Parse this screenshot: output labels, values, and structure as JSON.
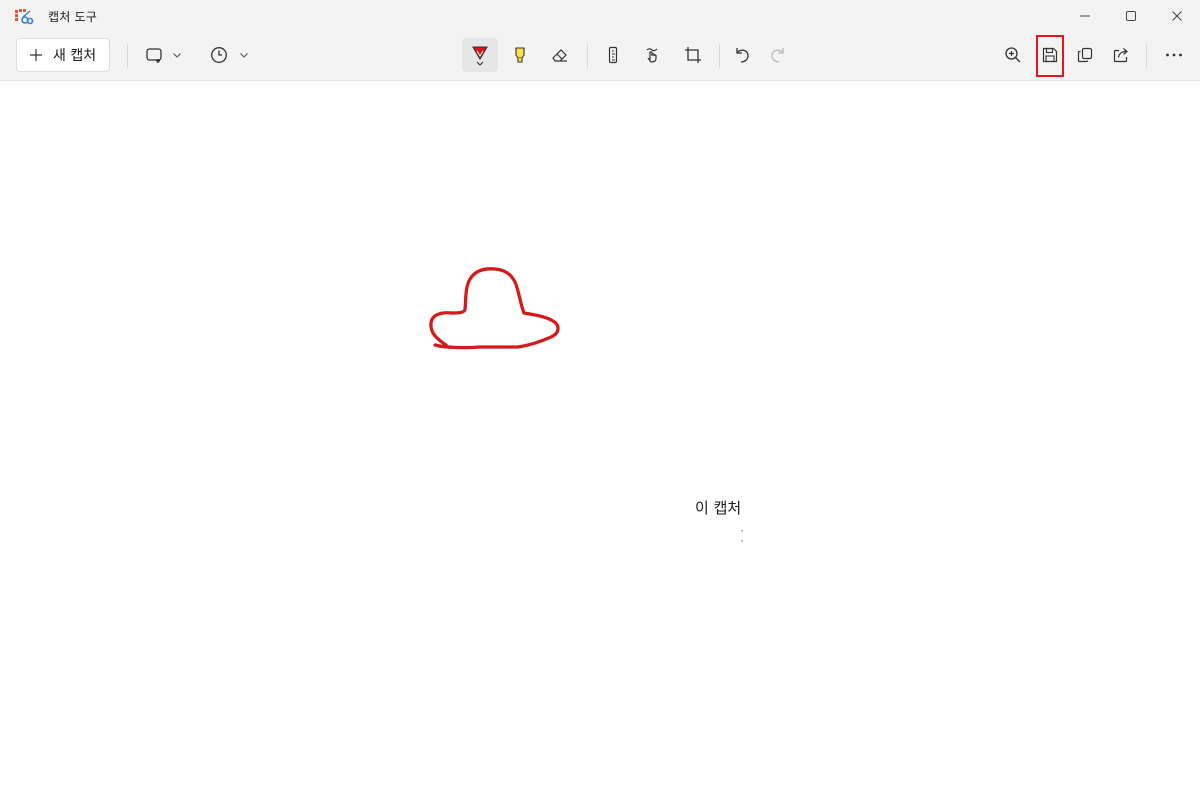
{
  "window": {
    "title": "캡처 도구",
    "icons": {
      "app": "snipping-tool-icon",
      "minimize": "minimize-icon",
      "maximize": "maximize-icon",
      "close": "close-icon"
    }
  },
  "toolbar": {
    "new_capture_label": "새 캡처",
    "icons": [
      "rectangle-mode-icon",
      "chevron-down-icon",
      "timer-icon",
      "chevron-down-icon",
      "ballpoint-pen-icon",
      "highlighter-icon",
      "eraser-icon",
      "ruler-icon",
      "touch-writing-icon",
      "crop-icon",
      "undo-icon",
      "redo-icon",
      "zoom-in-icon",
      "save-icon",
      "copy-icon",
      "share-icon",
      "more-icon"
    ],
    "pen_color": "#d0191f",
    "highlighter_color": "#ffe14a",
    "save_highlight_color": "#e3161a"
  },
  "canvas": {
    "caption": "이 캡처",
    "stroke_color": "#d21c1c"
  }
}
